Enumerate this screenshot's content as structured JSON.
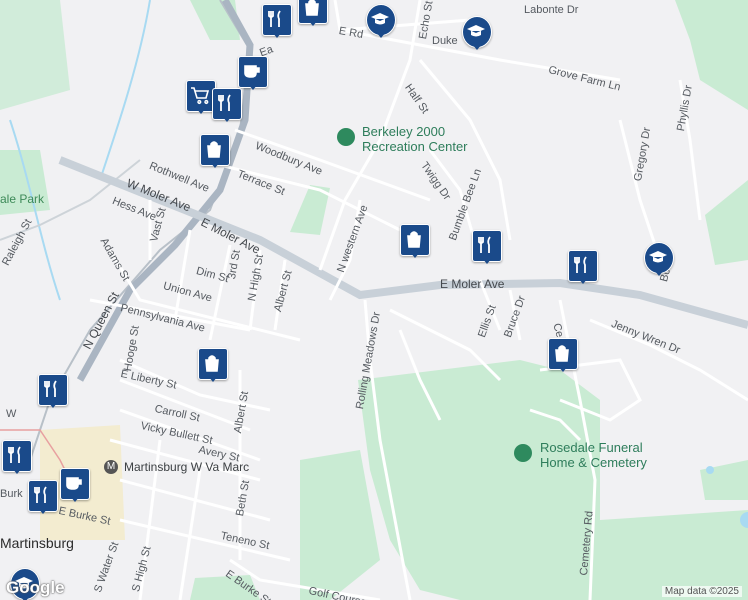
{
  "map": {
    "attribution": "Map data ©2025",
    "logo": "Google",
    "colors": {
      "background": "#f1f1f3",
      "park": "#c9ebd3",
      "road": "#ffffff",
      "highway": "#aab5c2",
      "water": "#a8daf2",
      "pin": "#1a4a8a",
      "poi": "#2e8a5e"
    }
  },
  "streets": [
    "Labonte Dr",
    "Echo St",
    "E Rd",
    "Duke",
    "Grove Farm Ln",
    "Half St",
    "Phyllis Dr",
    "Gregory Dr",
    "Rothwell Ave",
    "Woodbury Ave",
    "Terrace St",
    "W Moler Ave",
    "Twigg Dr",
    "Bumble Bee Ln",
    "Hess Ave",
    "Vast St",
    "E Moler Ave",
    "N western Ave",
    "Adams St",
    "3rd St",
    "N High St",
    "Dim St",
    "Union Ave",
    "Albert St",
    "Ellis St",
    "Bruce Dr",
    "Jenny Wren Dr",
    "N Queen St",
    "Pennsylvania Ave",
    "Hooge St",
    "Rolling Meadows Dr",
    "E Liberty St",
    "Carroll St",
    "Vicky Bullett St",
    "Avery St",
    "Albert St",
    "Beth St",
    "E Burke St",
    "Teneno St",
    "S Water St",
    "S High St",
    "Golf Course",
    "Cemetery Rd",
    "E Moler Ave",
    "Raleigh St",
    "Queen",
    "Bola",
    "Ea",
    "Burk",
    "W",
    "Ce",
    "E Burke St"
  ],
  "places": {
    "recreation_center": "Berkeley 2000\nRecreation Center",
    "funeral_home": "Rosedale Funeral\nHome & Cemetery",
    "amtrak": "Martinsburg W Va Marc",
    "city": "Martinsburg",
    "park": "ale Park"
  },
  "pins": [
    {
      "icon": "restaurant-icon"
    },
    {
      "icon": "shopping-icon"
    },
    {
      "icon": "school-icon"
    },
    {
      "icon": "school-icon"
    },
    {
      "icon": "cafe-icon"
    },
    {
      "icon": "grocery-icon"
    },
    {
      "icon": "restaurant-icon"
    },
    {
      "icon": "shopping-icon"
    },
    {
      "icon": "shopping-icon"
    },
    {
      "icon": "restaurant-icon"
    },
    {
      "icon": "restaurant-icon"
    },
    {
      "icon": "school-icon"
    },
    {
      "icon": "shopping-icon"
    },
    {
      "icon": "shopping-icon"
    },
    {
      "icon": "restaurant-icon"
    },
    {
      "icon": "restaurant-icon"
    },
    {
      "icon": "cafe-icon"
    },
    {
      "icon": "restaurant-icon"
    },
    {
      "icon": "school-icon"
    }
  ]
}
